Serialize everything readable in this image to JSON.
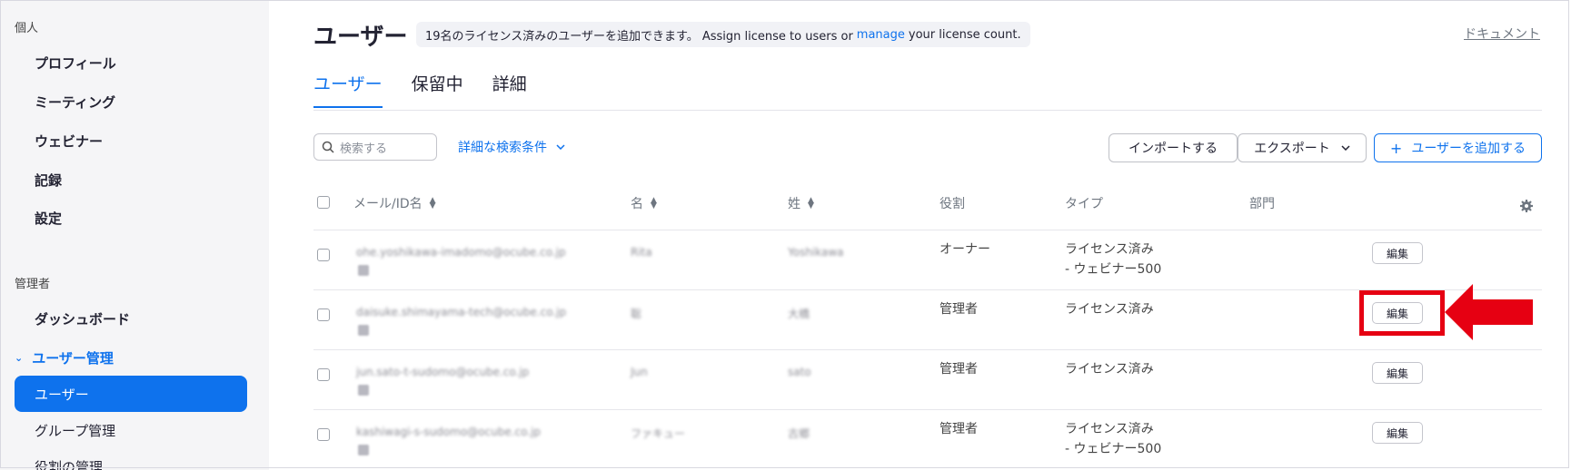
{
  "sidebar": {
    "personal_header": "個人",
    "personal_items": [
      "プロフィール",
      "ミーティング",
      "ウェビナー",
      "記録",
      "設定"
    ],
    "admin_header": "管理者",
    "dashboard": "ダッシュボード",
    "user_mgmt": "ユーザー管理",
    "active_item": "ユーザー",
    "group_mgmt": "グループ管理",
    "role_mgmt": "役割の管理"
  },
  "header": {
    "title": "ユーザー",
    "license_text_1": "19名のライセンス済みのユーザーを追加できます。 Assign license to users or",
    "license_link": "manage",
    "license_text_2": "your license count.",
    "doc_link": "ドキュメント"
  },
  "tabs": [
    "ユーザー",
    "保留中",
    "詳細"
  ],
  "toolbar": {
    "search_placeholder": "検索する",
    "advanced_search": "詳細な検索条件",
    "import": "インポートする",
    "export": "エクスポート",
    "add_user": "ユーザーを追加する"
  },
  "columns": {
    "email": "メール/ID名",
    "first_name": "名",
    "last_name": "姓",
    "role": "役割",
    "type": "タイプ",
    "department": "部門"
  },
  "rows": [
    {
      "email": "ohe.yoshikawa-imadomo@ocube.co.jp",
      "first": "Rita",
      "last": "Yoshikawa",
      "role": "オーナー",
      "type1": "ライセンス済み",
      "type2": "- ウェビナー500",
      "edit": "編集"
    },
    {
      "email": "daisuke.shimayama-tech@ocube.co.jp",
      "first": "聡",
      "last": "大橋",
      "role": "管理者",
      "type1": "ライセンス済み",
      "type2": "",
      "edit": "編集"
    },
    {
      "email": "jun.sato-t-sudomo@ocube.co.jp",
      "first": "Jun",
      "last": "sato",
      "role": "管理者",
      "type1": "ライセンス済み",
      "type2": "",
      "edit": "編集"
    },
    {
      "email": "kashiwagi-s-sudomo@ocube.co.jp",
      "first": "ファキュー",
      "last": "古郷",
      "role": "管理者",
      "type1": "ライセンス済み",
      "type2": "- ウェビナー500",
      "edit": "編集"
    }
  ],
  "colors": {
    "accent": "#0e72ed",
    "highlight": "#e60012"
  }
}
